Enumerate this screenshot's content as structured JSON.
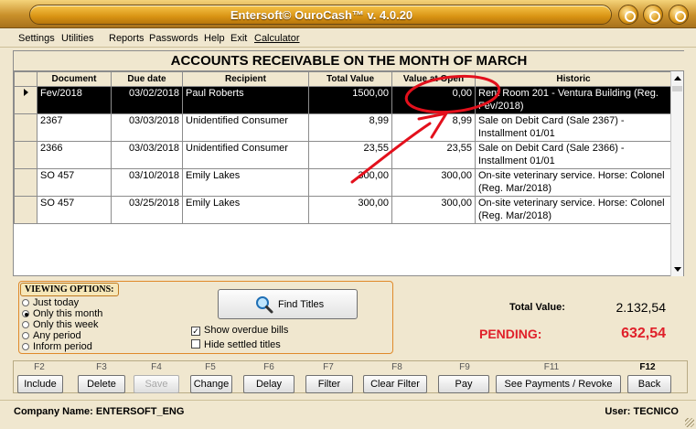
{
  "window": {
    "title": "Entersoft© OuroCash™ v. 4.0.20",
    "controls": [
      "minimize-icon",
      "maximize-icon",
      "close-icon"
    ]
  },
  "menu": {
    "settings": "Settings",
    "utilities": "Utilities",
    "reports": "Reports",
    "passwords": "Passwords",
    "help": "Help",
    "exit": "Exit",
    "calculator": "Calculator"
  },
  "grid": {
    "title": "ACCOUNTS RECEIVABLE ON THE MONTH OF MARCH",
    "columns": [
      "Document",
      "Due date",
      "Recipient",
      "Total Value",
      "Value at Open",
      "Historic"
    ],
    "rows": [
      {
        "document": "Fev/2018",
        "due_date": "03/02/2018",
        "recipient": "Paul Roberts",
        "total_value": "1500,00",
        "value_at_open": "0,00",
        "historic": "Rent Room 201 - Ventura Building (Reg. Fev/2018)",
        "selected": true
      },
      {
        "document": "2367",
        "due_date": "03/03/2018",
        "recipient": "Unidentified Consumer",
        "total_value": "8,99",
        "value_at_open": "8,99",
        "historic": "Sale on Debit Card (Sale 2367) - Installment 01/01",
        "selected": false
      },
      {
        "document": "2366",
        "due_date": "03/03/2018",
        "recipient": "Unidentified Consumer",
        "total_value": "23,55",
        "value_at_open": "23,55",
        "historic": "Sale on Debit Card (Sale 2366) - Installment 01/01",
        "selected": false
      },
      {
        "document": "SO 457",
        "due_date": "03/10/2018",
        "recipient": "Emily Lakes",
        "total_value": "300,00",
        "value_at_open": "300,00",
        "historic": "On-site veterinary service. Horse: Colonel (Reg. Mar/2018)",
        "selected": false
      },
      {
        "document": "SO 457",
        "due_date": "03/25/2018",
        "recipient": "Emily Lakes",
        "total_value": "300,00",
        "value_at_open": "300,00",
        "historic": "On-site veterinary service. Horse: Colonel (Reg. Mar/2018)",
        "selected": false
      }
    ]
  },
  "viewing_options": {
    "label": "VIEWING OPTIONS:",
    "options": [
      "Just today",
      "Only this month",
      "Only this week",
      "Any period",
      "Inform period"
    ],
    "selected": "Only this month"
  },
  "find_button": "Find Titles",
  "checkboxes": {
    "show_overdue": {
      "label": "Show overdue bills",
      "checked": true
    },
    "hide_settled": {
      "label": "Hide settled titles",
      "checked": false
    }
  },
  "totals": {
    "total_label": "Total Value:",
    "total_value": "2.132,54",
    "pending_label": "PENDING:",
    "pending_value": "632,54",
    "pending_color": "#e0202a"
  },
  "function_keys": [
    {
      "key": "F2",
      "label": "Include",
      "enabled": true
    },
    {
      "key": "F3",
      "label": "Delete",
      "enabled": true
    },
    {
      "key": "F4",
      "label": "Save",
      "enabled": false
    },
    {
      "key": "F5",
      "label": "Change",
      "enabled": true
    },
    {
      "key": "F6",
      "label": "Delay",
      "enabled": true
    },
    {
      "key": "F7",
      "label": "Filter",
      "enabled": true
    },
    {
      "key": "F8",
      "label": "Clear Filter",
      "enabled": true
    },
    {
      "key": "F9",
      "label": "Pay",
      "enabled": true
    },
    {
      "key": "F11",
      "label": "See Payments / Revoke",
      "enabled": true
    },
    {
      "key": "F12",
      "label": "Back",
      "enabled": true
    }
  ],
  "status": {
    "company": "Company Name: ENTERSOFT_ENG",
    "user": "User: TECNICO"
  },
  "annotation": {
    "color": "#e3101c"
  }
}
